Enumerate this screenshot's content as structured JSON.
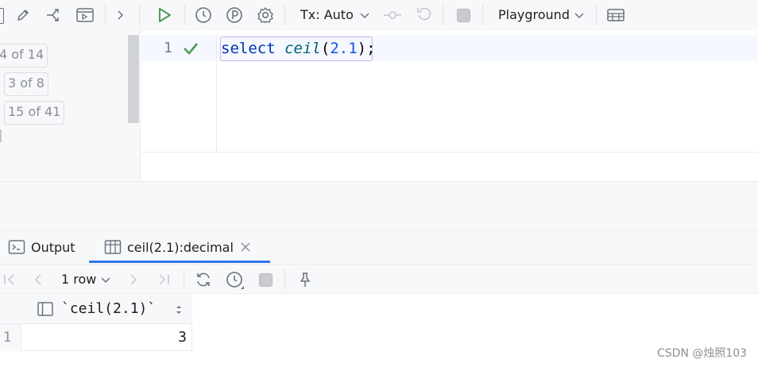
{
  "toolbar": {
    "tx_label": "Tx: Auto",
    "session_label": "Playground",
    "icons": [
      "panel-icon",
      "edit-icon",
      "merge-icon",
      "run-console-icon",
      "chevron-right-icon",
      "run-icon",
      "history-icon",
      "explain-plan-icon",
      "settings-icon",
      "chevron-down-icon",
      "commit-icon",
      "rollback-icon",
      "stop-icon",
      "chevron-down-icon",
      "table-view-icon"
    ]
  },
  "left_panel": {
    "badges": [
      "4 of 14",
      "3 of 8",
      "15 of 41"
    ]
  },
  "editor": {
    "line_number": "1",
    "status": "check-icon",
    "code": {
      "keyword": "select",
      "function": "ceil",
      "paren_open": "(",
      "number": "2.1",
      "paren_close": ")",
      "semicolon": ";"
    }
  },
  "tabs": {
    "output_label": "Output",
    "result_label": "ceil(2.1):decimal"
  },
  "results_toolbar": {
    "rows_label": "1 row"
  },
  "grid": {
    "column_header": "`ceil(2.1)`",
    "rows": [
      {
        "num": "1",
        "value": "3"
      }
    ]
  },
  "watermark": "CSDN @烛照103",
  "colors": {
    "accent": "#3574f0",
    "run_green": "#499c54",
    "keyword": "#0033b3",
    "function": "#00627a",
    "number": "#1750eb"
  }
}
